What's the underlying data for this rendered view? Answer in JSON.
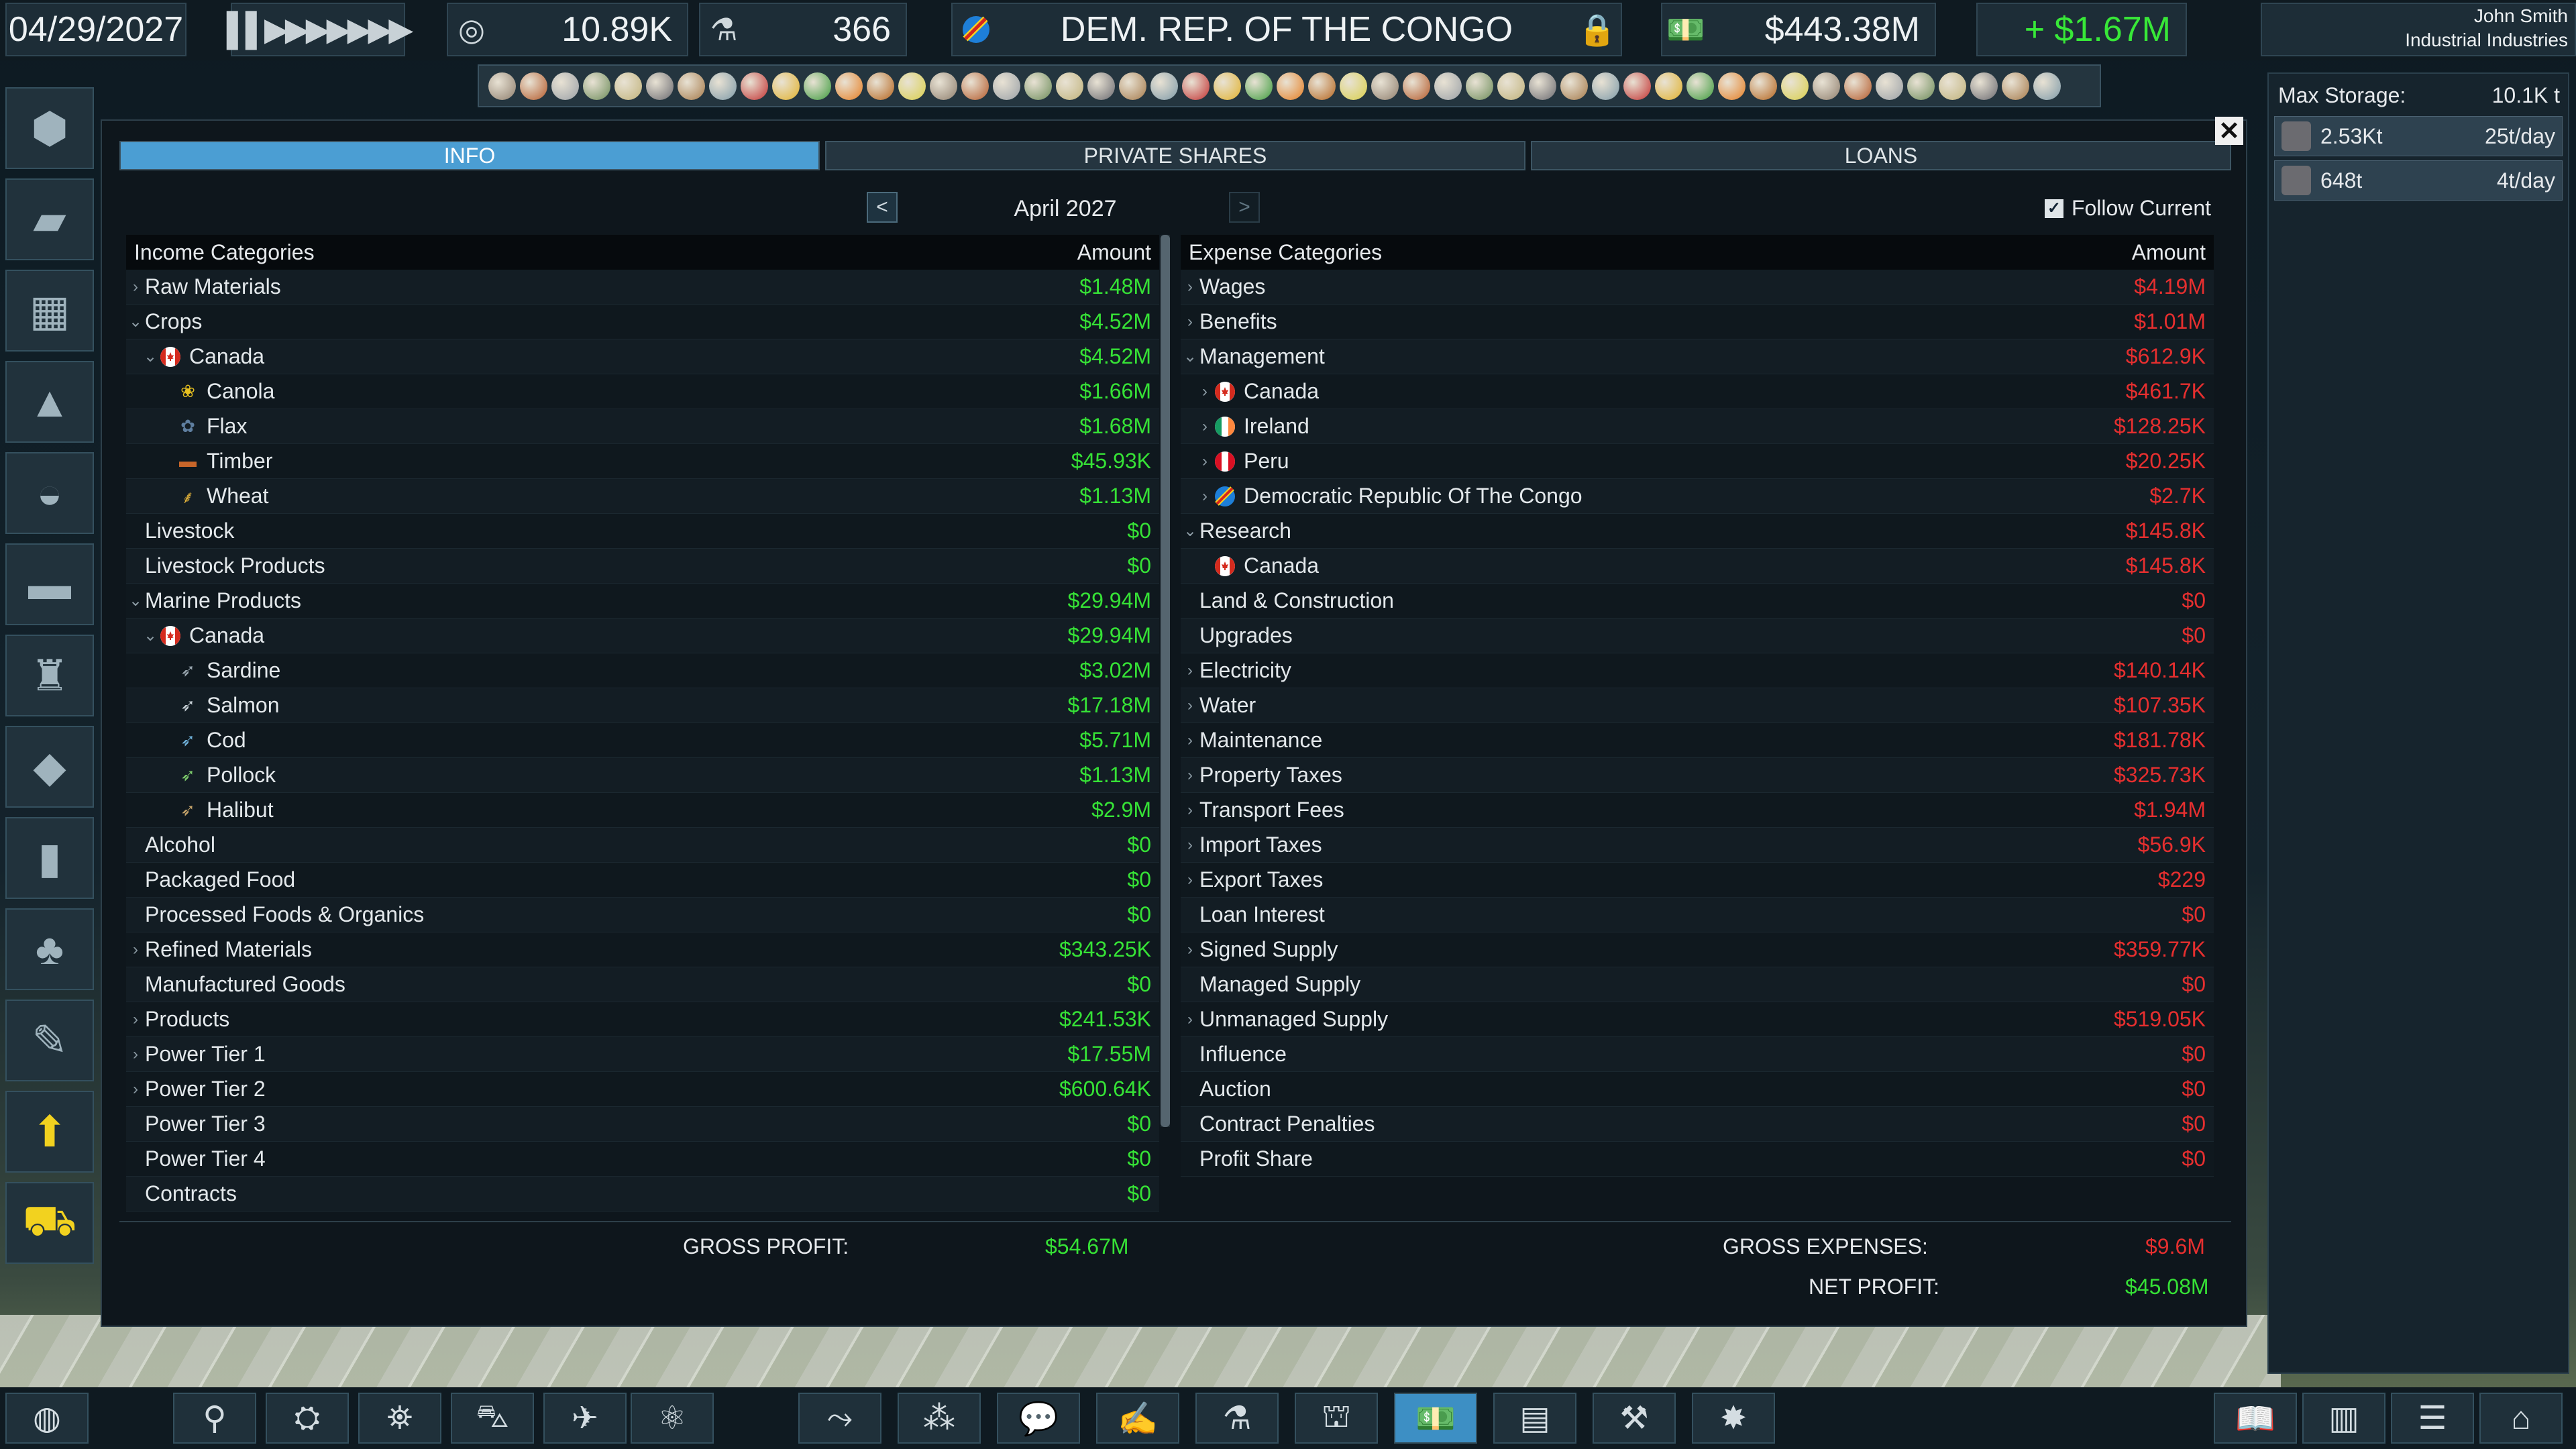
{
  "topbar": {
    "date": "04/29/2027",
    "speed_glyph": "▌▌▶▶▶▶▶▶▶",
    "research": "10.89K",
    "influence": "366",
    "country": "DEM. REP. OF THE CONGO",
    "cash": "$443.38M",
    "gain": "+ $1.67M",
    "user_name": "John Smith",
    "company": "Industrial Industries"
  },
  "tabs": [
    "INFO",
    "PRIVATE SHARES",
    "LOANS"
  ],
  "period": {
    "prev": "<",
    "label": "April 2027",
    "next": ">",
    "follow": "Follow Current",
    "follow_checked": true
  },
  "income": {
    "header": "Income Categories",
    "amount_header": "Amount",
    "rows": [
      {
        "label": "Raw Materials",
        "amount": "$1.48M",
        "arrow": "›",
        "indent": 0
      },
      {
        "label": "Crops",
        "amount": "$4.52M",
        "arrow": "⌄",
        "indent": 0
      },
      {
        "label": "Canada",
        "amount": "$4.52M",
        "arrow": "⌄",
        "indent": 1,
        "flag": "canada"
      },
      {
        "label": "Canola",
        "amount": "$1.66M",
        "indent": 2,
        "item": "canola-icon"
      },
      {
        "label": "Flax",
        "amount": "$1.68M",
        "indent": 2,
        "item": "flax-icon"
      },
      {
        "label": "Timber",
        "amount": "$45.93K",
        "indent": 2,
        "item": "timber-icon"
      },
      {
        "label": "Wheat",
        "amount": "$1.13M",
        "indent": 2,
        "item": "wheat-icon"
      },
      {
        "label": "Livestock",
        "amount": "$0",
        "indent": 0
      },
      {
        "label": "Livestock Products",
        "amount": "$0",
        "indent": 0
      },
      {
        "label": "Marine Products",
        "amount": "$29.94M",
        "arrow": "⌄",
        "indent": 0
      },
      {
        "label": "Canada",
        "amount": "$29.94M",
        "arrow": "⌄",
        "indent": 1,
        "flag": "canada"
      },
      {
        "label": "Sardine",
        "amount": "$3.02M",
        "indent": 2,
        "item": "sardine-icon"
      },
      {
        "label": "Salmon",
        "amount": "$17.18M",
        "indent": 2,
        "item": "salmon-icon"
      },
      {
        "label": "Cod",
        "amount": "$5.71M",
        "indent": 2,
        "item": "cod-icon"
      },
      {
        "label": "Pollock",
        "amount": "$1.13M",
        "indent": 2,
        "item": "pollock-icon"
      },
      {
        "label": "Halibut",
        "amount": "$2.9M",
        "indent": 2,
        "item": "halibut-icon"
      },
      {
        "label": "Alcohol",
        "amount": "$0",
        "indent": 0
      },
      {
        "label": "Packaged Food",
        "amount": "$0",
        "indent": 0
      },
      {
        "label": "Processed Foods & Organics",
        "amount": "$0",
        "indent": 0
      },
      {
        "label": "Refined Materials",
        "amount": "$343.25K",
        "arrow": "›",
        "indent": 0
      },
      {
        "label": "Manufactured Goods",
        "amount": "$0",
        "indent": 0
      },
      {
        "label": "Products",
        "amount": "$241.53K",
        "arrow": "›",
        "indent": 0
      },
      {
        "label": "Power Tier 1",
        "amount": "$17.55M",
        "arrow": "›",
        "indent": 0
      },
      {
        "label": "Power Tier 2",
        "amount": "$600.64K",
        "arrow": "›",
        "indent": 0
      },
      {
        "label": "Power Tier 3",
        "amount": "$0",
        "indent": 0
      },
      {
        "label": "Power Tier 4",
        "amount": "$0",
        "indent": 0
      },
      {
        "label": "Contracts",
        "amount": "$0",
        "indent": 0
      }
    ]
  },
  "expenses": {
    "header": "Expense Categories",
    "amount_header": "Amount",
    "rows": [
      {
        "label": "Wages",
        "amount": "$4.19M",
        "arrow": "›",
        "indent": 0
      },
      {
        "label": "Benefits",
        "amount": "$1.01M",
        "arrow": "›",
        "indent": 0
      },
      {
        "label": "Management",
        "amount": "$612.9K",
        "arrow": "⌄",
        "indent": 0
      },
      {
        "label": "Canada",
        "amount": "$461.7K",
        "arrow": "›",
        "indent": 1,
        "flag": "canada"
      },
      {
        "label": "Ireland",
        "amount": "$128.25K",
        "arrow": "›",
        "indent": 1,
        "flag": "ireland"
      },
      {
        "label": "Peru",
        "amount": "$20.25K",
        "arrow": "›",
        "indent": 1,
        "flag": "peru"
      },
      {
        "label": "Democratic Republic Of The Congo",
        "amount": "$2.7K",
        "arrow": "›",
        "indent": 1,
        "flag": "drc"
      },
      {
        "label": "Research",
        "amount": "$145.8K",
        "arrow": "⌄",
        "indent": 0
      },
      {
        "label": "Canada",
        "amount": "$145.8K",
        "indent": 1,
        "flag": "canada"
      },
      {
        "label": "Land & Construction",
        "amount": "$0",
        "indent": 0
      },
      {
        "label": "Upgrades",
        "amount": "$0",
        "indent": 0
      },
      {
        "label": "Electricity",
        "amount": "$140.14K",
        "arrow": "›",
        "indent": 0
      },
      {
        "label": "Water",
        "amount": "$107.35K",
        "arrow": "›",
        "indent": 0
      },
      {
        "label": "Maintenance",
        "amount": "$181.78K",
        "arrow": "›",
        "indent": 0
      },
      {
        "label": "Property Taxes",
        "amount": "$325.73K",
        "arrow": "›",
        "indent": 0
      },
      {
        "label": "Transport Fees",
        "amount": "$1.94M",
        "arrow": "›",
        "indent": 0
      },
      {
        "label": "Import Taxes",
        "amount": "$56.9K",
        "arrow": "›",
        "indent": 0
      },
      {
        "label": "Export Taxes",
        "amount": "$229",
        "arrow": "›",
        "indent": 0
      },
      {
        "label": "Loan Interest",
        "amount": "$0",
        "indent": 0
      },
      {
        "label": "Signed Supply",
        "amount": "$359.77K",
        "arrow": "›",
        "indent": 0
      },
      {
        "label": "Managed Supply",
        "amount": "$0",
        "indent": 0
      },
      {
        "label": "Unmanaged Supply",
        "amount": "$519.05K",
        "arrow": "›",
        "indent": 0
      },
      {
        "label": "Influence",
        "amount": "$0",
        "indent": 0
      },
      {
        "label": "Auction",
        "amount": "$0",
        "indent": 0
      },
      {
        "label": "Contract Penalties",
        "amount": "$0",
        "indent": 0
      },
      {
        "label": "Profit Share",
        "amount": "$0",
        "indent": 0
      }
    ]
  },
  "totals": {
    "gross_profit_label": "GROSS PROFIT:",
    "gross_profit": "$54.67M",
    "gross_expenses_label": "GROSS EXPENSES:",
    "gross_expenses": "$9.6M",
    "net_profit_label": "NET PROFIT:",
    "net_profit": "$45.08M"
  },
  "storage": {
    "title": "Max Storage:",
    "max": "10.1K t",
    "items": [
      {
        "amount": "2.53Kt",
        "rate": "25t/day"
      },
      {
        "amount": "648t",
        "rate": "4t/day"
      }
    ]
  },
  "colors": {
    "income": "#36e236",
    "expense": "#e62f2f",
    "active_tab": "#4b9ed3"
  },
  "left_sidebar_icons": [
    "hex-map-icon",
    "warehouse-icon",
    "factory-icon",
    "farm-icon",
    "mine-icon",
    "ranch-icon",
    "refinery-icon",
    "shipyard-icon",
    "power-plant-icon",
    "forest-icon",
    "eyedropper-icon",
    "upgrade-arrow-icon",
    "bulldozer-icon"
  ],
  "bottom_icons": [
    "globe-icon",
    "research-icon",
    "logistics-icon",
    "satellite-icon",
    "transport-icon",
    "drone-icon",
    "atom-icon",
    "route-icon",
    "network-icon",
    "chat-icon",
    "contracts-icon",
    "lab-icon",
    "market-icon",
    "finance-icon",
    "report-icon",
    "crane-icon",
    "events-icon",
    "encyclopedia-icon",
    "notes-icon",
    "list-icon",
    "home-icon"
  ]
}
